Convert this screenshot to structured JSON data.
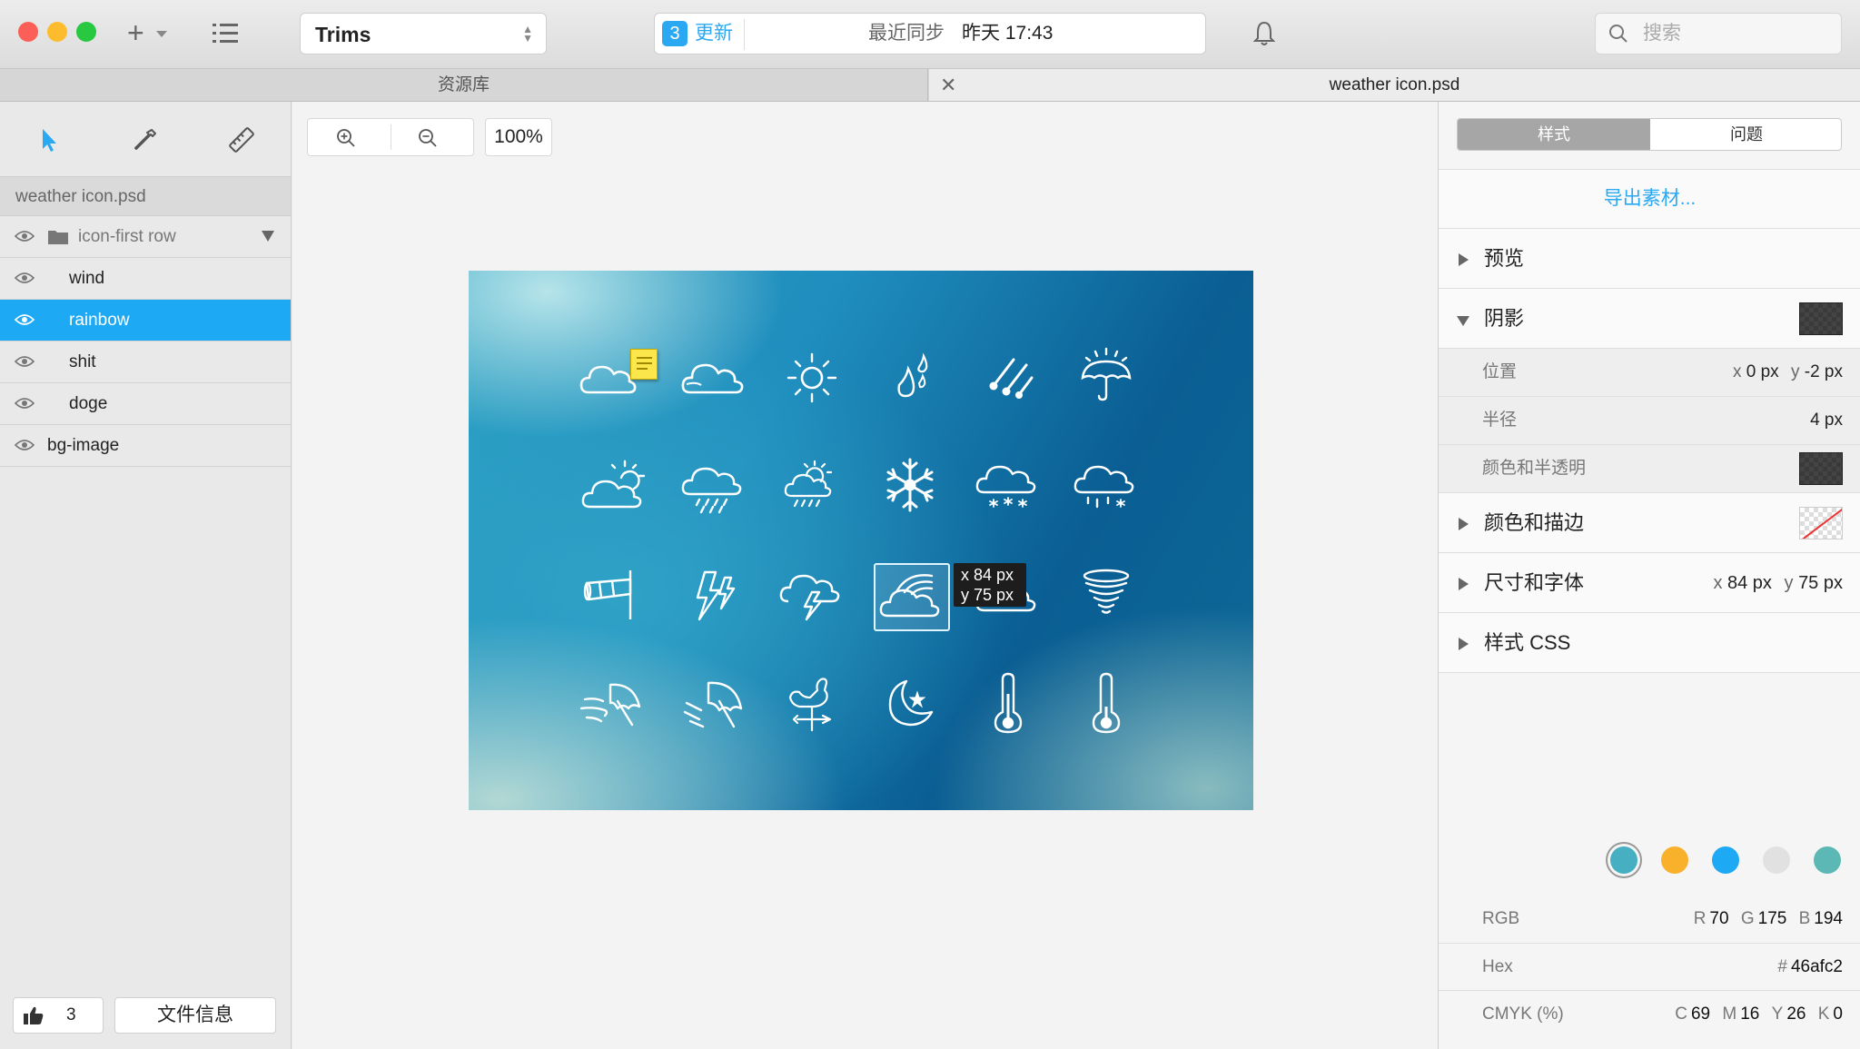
{
  "titlebar": {
    "project": "Trims",
    "update_count": "3",
    "update_label": "更新",
    "sync_label": "最近同步",
    "sync_time": "昨天 17:43",
    "search_placeholder": "搜索"
  },
  "tabs": {
    "library": "资源库",
    "document": "weather icon.psd"
  },
  "left_panel": {
    "file_name": "weather icon.psd",
    "group_name": "icon-first row",
    "layers": [
      "wind",
      "rainbow",
      "shit",
      "doge",
      "bg-image"
    ],
    "selected_layer": "rainbow",
    "like_count": "3",
    "file_info_label": "文件信息"
  },
  "canvas": {
    "zoom": "100%",
    "measure_x": "x 84 px",
    "measure_y": "y 75 px"
  },
  "right_panel": {
    "tab_style": "样式",
    "tab_issues": "问题",
    "export_label": "导出素材...",
    "preview_label": "预览",
    "shadow_label": "阴影",
    "position_label": "位置",
    "position_x_key": "x",
    "position_x": "0 px",
    "position_y_key": "y",
    "position_y": "-2 px",
    "radius_label": "半径",
    "radius_value": "4 px",
    "color_opacity_label": "颜色和半透明",
    "fill_stroke_label": "颜色和描边",
    "size_font_label": "尺寸和字体",
    "size_x_key": "x",
    "size_x": "84 px",
    "size_y_key": "y",
    "size_y": "75 px",
    "css_label": "样式 CSS",
    "palette": [
      "#46afc2",
      "#f9b12b",
      "#1ea9f5",
      "#e1e1e1",
      "#5bb8b4"
    ],
    "rgb_label": "RGB",
    "r_key": "R",
    "r_value": "70",
    "g_key": "G",
    "g_value": "175",
    "b_key": "B",
    "b_value": "194",
    "hex_label": "Hex",
    "hex_key": "#",
    "hex_value": "46afc2",
    "cmyk_label": "CMYK (%)",
    "c_key": "C",
    "c_value": "69",
    "m_key": "M",
    "m_value": "16",
    "y_key": "Y",
    "y_value": "26",
    "k_key": "K",
    "k_value": "0"
  },
  "colors": {
    "accent": "#2aa8f2",
    "selection": "#1ea9f5",
    "close_light": "#fc5f57",
    "minimize_light": "#fdbc2e",
    "zoom_light": "#28c840"
  },
  "icons": {
    "row1": [
      "cloud-icon",
      "cloud-icon",
      "sun-icon",
      "raindrops-icon",
      "meteor-icon",
      "umbrella-sun-icon"
    ],
    "row2": [
      "partly-sunny-icon",
      "cloud-rain-icon",
      "sun-cloud-rain-icon",
      "snowflake-icon",
      "cloud-snow-icon",
      "cloud-sleet-icon"
    ],
    "row3": [
      "windsock-icon",
      "lightning-icon",
      "cloud-lightning-icon",
      "cloud-rainbow-icon",
      "cloud-icon",
      "tornado-icon"
    ],
    "row4": [
      "wind-umbrella-icon",
      "rain-umbrella-icon",
      "weathervane-icon",
      "moon-star-icon",
      "thermometer-icon",
      "thermometer-icon"
    ]
  }
}
